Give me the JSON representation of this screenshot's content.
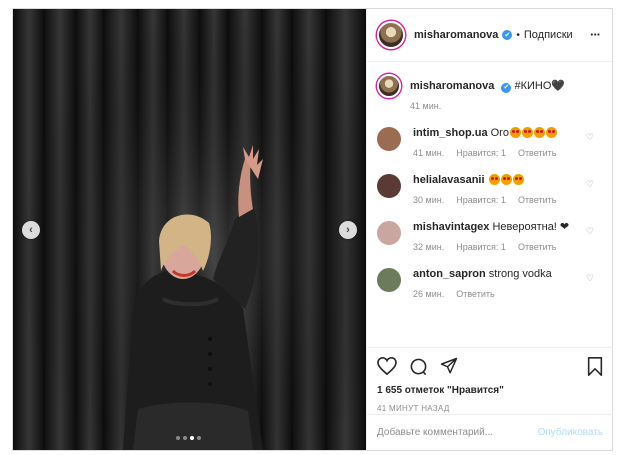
{
  "header": {
    "username": "misharomanova",
    "verified": "✔",
    "separator": "•",
    "follow_label": "Подписки",
    "more_icon": "···"
  },
  "caption": {
    "username": "misharomanova",
    "text": "#КИНО🖤",
    "time": "41 мин."
  },
  "comments": [
    {
      "username": "intim_shop.ua",
      "text": "Оrо",
      "emoji_count": 4,
      "time": "41 мин.",
      "likes": "Нравится: 1",
      "reply": "Ответить",
      "avatar_color": "#9b6b52"
    },
    {
      "username": "helialavasanii",
      "text": "",
      "emoji_count": 3,
      "time": "30 мин.",
      "likes": "Нравится: 1",
      "reply": "Ответить",
      "avatar_color": "#5a3a34"
    },
    {
      "username": "mishavintagex",
      "text": "Невероятна! ❤",
      "emoji_count": 0,
      "time": "32 мин.",
      "likes": "Нравится: 1",
      "reply": "Ответить",
      "avatar_color": "#c9a7a0"
    },
    {
      "username": "anton_sapron",
      "text": "strong vodka",
      "emoji_count": 0,
      "time": "26 мин.",
      "likes": "",
      "reply": "Ответить",
      "avatar_color": "#6b7b5c"
    }
  ],
  "actions": {
    "likes_text": "1 655 отметок \"Нравится\"",
    "posted_ago": "41 МИНУТ НАЗАД"
  },
  "add_comment": {
    "placeholder": "Добавьте комментарий...",
    "post_label": "Опубликовать"
  },
  "carousel": {
    "prev_icon": "‹",
    "next_icon": "›",
    "slide_count": 4,
    "active_slide": 3
  },
  "colors": {
    "verified": "#3897f0",
    "post_disabled": "#b3dbff",
    "muted": "#8e8e8e",
    "heart_red": "#ed4956"
  }
}
